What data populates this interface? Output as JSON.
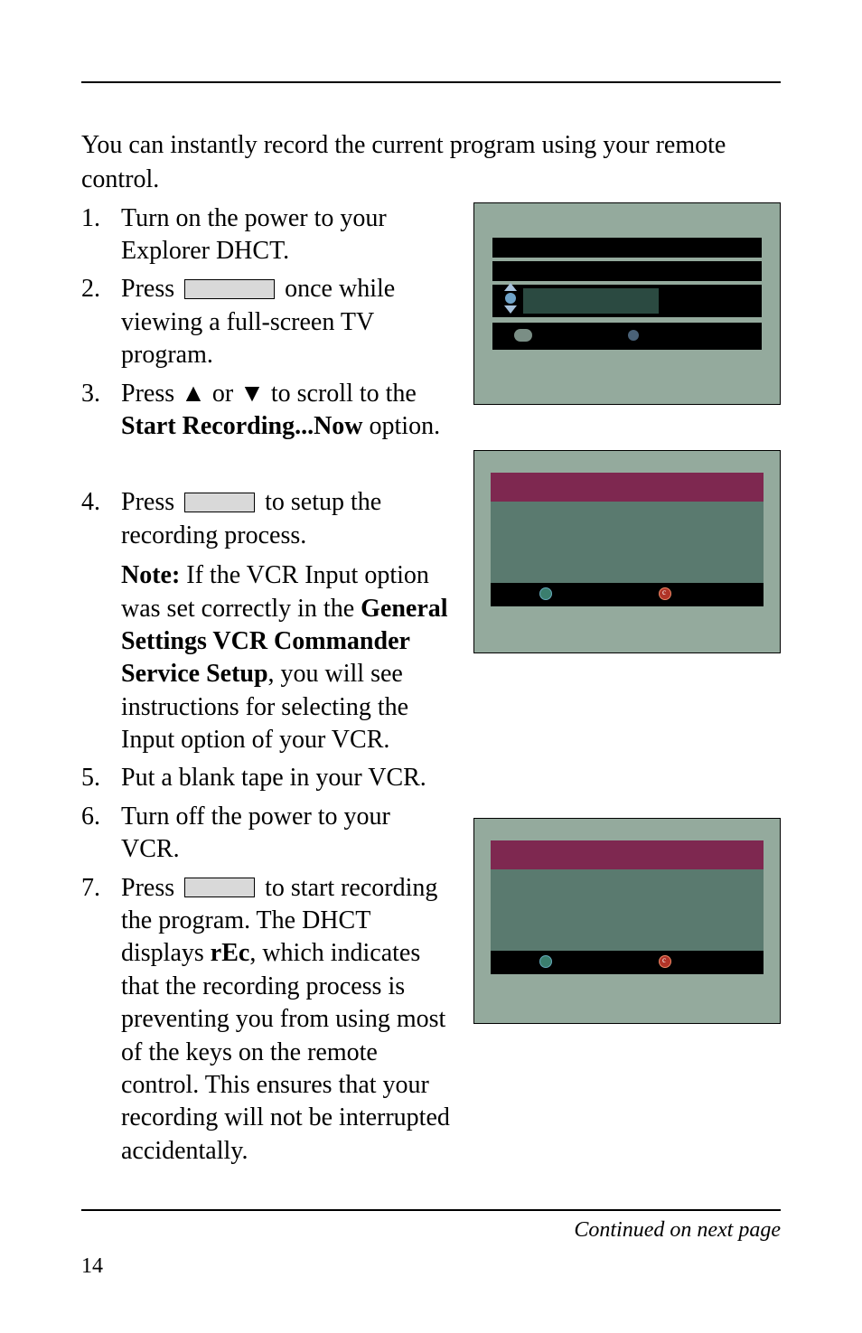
{
  "intro": "You can instantly record the current program using your remote control.",
  "steps": {
    "s1": "Turn on the power to your Explorer DHCT.",
    "s2a": "Press ",
    "s2b": " once while viewing a full-screen TV program.",
    "s3a": "Press ▲ or ▼ to scroll to the ",
    "s3b": "Start Recording...Now",
    "s3c": " option.",
    "s4a": "Press ",
    "s4b": " to setup the recording process.",
    "s4note_label": "Note:",
    "s4note_a": " If the VCR Input option was set correctly in the ",
    "s4note_b": "General Settings VCR Commander Service Setup",
    "s4note_c": ", you will see instructions for selecting the Input option of your VCR.",
    "s5": "Put a blank tape in your VCR.",
    "s6": "Turn off the power to your VCR.",
    "s7a": "Press ",
    "s7b": " to start recording the program. The DHCT displays ",
    "s7c": "rEc",
    "s7d": ", which indicates that the recording process is preventing you from using most of the keys on the remote control. This ensures that your recording will not be interrupted accidentally."
  },
  "continued": "Continued on next page",
  "page_number": "14"
}
